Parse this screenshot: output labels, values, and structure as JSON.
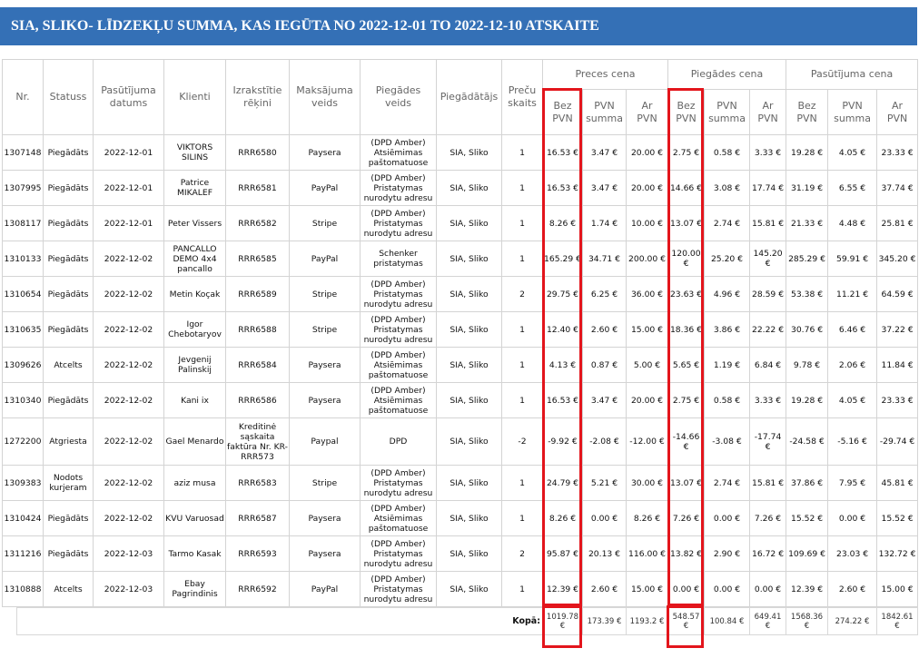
{
  "title": "SIA, SLIKO- LĪDZEKĻU SUMMA, KAS IEGŪTA NO 2022-12-01 TO 2022-12-10 ATSKAITE",
  "colors": {
    "title_bar": "#3470b6",
    "title_text": "#ffffff",
    "highlight": "#e3151c"
  },
  "table": {
    "headers": {
      "nr": "Nr.",
      "status": "Statuss",
      "order_date": "Pasūtījuma datums",
      "client": "Klienti",
      "invoices": "Izrakstītie rēķini",
      "payment": "Maksājuma veids",
      "delivery": "Piegādes veids",
      "supplier": "Piegādātājs",
      "qty": "Preču skaits",
      "groups": [
        "Preces cena",
        "Piegādes cena",
        "Pasūtījuma cena"
      ],
      "sub": [
        "Bez PVN",
        "PVN summa",
        "Ar PVN"
      ]
    },
    "rows": [
      {
        "nr": "1307148",
        "status": "Piegādāts",
        "date": "2022-12-01",
        "client": "VIKTORS SILINS",
        "invoice": "RRR6580",
        "payment": "Paysera",
        "delivery": "(DPD Amber) Atsiēmimas paštomatuose",
        "supplier": "SIA, Sliko",
        "qty": "1",
        "goods": [
          "16.53 €",
          "3.47 €",
          "20.00 €"
        ],
        "shipping": [
          "2.75 €",
          "0.58 €",
          "3.33 €"
        ],
        "order": [
          "19.28 €",
          "4.05 €",
          "23.33 €"
        ]
      },
      {
        "nr": "1307995",
        "status": "Piegādāts",
        "date": "2022-12-01",
        "client": "Patrice MIKALEF",
        "invoice": "RRR6581",
        "payment": "PayPal",
        "delivery": "(DPD Amber) Pristatymas nurodytu adresu",
        "supplier": "SIA, Sliko",
        "qty": "1",
        "goods": [
          "16.53 €",
          "3.47 €",
          "20.00 €"
        ],
        "shipping": [
          "14.66 €",
          "3.08 €",
          "17.74 €"
        ],
        "order": [
          "31.19 €",
          "6.55 €",
          "37.74 €"
        ]
      },
      {
        "nr": "1308117",
        "status": "Piegādāts",
        "date": "2022-12-01",
        "client": "Peter Vissers",
        "invoice": "RRR6582",
        "payment": "Stripe",
        "delivery": "(DPD Amber) Pristatymas nurodytu adresu",
        "supplier": "SIA, Sliko",
        "qty": "1",
        "goods": [
          "8.26 €",
          "1.74 €",
          "10.00 €"
        ],
        "shipping": [
          "13.07 €",
          "2.74 €",
          "15.81 €"
        ],
        "order": [
          "21.33 €",
          "4.48 €",
          "25.81 €"
        ]
      },
      {
        "nr": "1310133",
        "status": "Piegādāts",
        "date": "2022-12-02",
        "client": "PANCALLO DEMO 4x4 pancallo",
        "invoice": "RRR6585",
        "payment": "PayPal",
        "delivery": "Schenker pristatymas",
        "supplier": "SIA, Sliko",
        "qty": "1",
        "goods": [
          "165.29 €",
          "34.71 €",
          "200.00 €"
        ],
        "shipping": [
          "120.00 €",
          "25.20 €",
          "145.20 €"
        ],
        "order": [
          "285.29 €",
          "59.91 €",
          "345.20 €"
        ]
      },
      {
        "nr": "1310654",
        "status": "Piegādāts",
        "date": "2022-12-02",
        "client": "Metin Koçak",
        "invoice": "RRR6589",
        "payment": "Stripe",
        "delivery": "(DPD Amber) Pristatymas nurodytu adresu",
        "supplier": "SIA, Sliko",
        "qty": "2",
        "goods": [
          "29.75 €",
          "6.25 €",
          "36.00 €"
        ],
        "shipping": [
          "23.63 €",
          "4.96 €",
          "28.59 €"
        ],
        "order": [
          "53.38 €",
          "11.21 €",
          "64.59 €"
        ]
      },
      {
        "nr": "1310635",
        "status": "Piegādāts",
        "date": "2022-12-02",
        "client": "Igor Chebotaryov",
        "invoice": "RRR6588",
        "payment": "Stripe",
        "delivery": "(DPD Amber) Pristatymas nurodytu adresu",
        "supplier": "SIA, Sliko",
        "qty": "1",
        "goods": [
          "12.40 €",
          "2.60 €",
          "15.00 €"
        ],
        "shipping": [
          "18.36 €",
          "3.86 €",
          "22.22 €"
        ],
        "order": [
          "30.76 €",
          "6.46 €",
          "37.22 €"
        ]
      },
      {
        "nr": "1309626",
        "status": "Atcelts",
        "date": "2022-12-02",
        "client": "Jevgenij Palinskij",
        "invoice": "RRR6584",
        "payment": "Paysera",
        "delivery": "(DPD Amber) Atsiēmimas paštomatuose",
        "supplier": "SIA, Sliko",
        "qty": "1",
        "goods": [
          "4.13 €",
          "0.87 €",
          "5.00 €"
        ],
        "shipping": [
          "5.65 €",
          "1.19 €",
          "6.84 €"
        ],
        "order": [
          "9.78 €",
          "2.06 €",
          "11.84 €"
        ]
      },
      {
        "nr": "1310340",
        "status": "Piegādāts",
        "date": "2022-12-02",
        "client": "Kani ix",
        "invoice": "RRR6586",
        "payment": "Paysera",
        "delivery": "(DPD Amber) Atsiēmimas paštomatuose",
        "supplier": "SIA, Sliko",
        "qty": "1",
        "goods": [
          "16.53 €",
          "3.47 €",
          "20.00 €"
        ],
        "shipping": [
          "2.75 €",
          "0.58 €",
          "3.33 €"
        ],
        "order": [
          "19.28 €",
          "4.05 €",
          "23.33 €"
        ]
      },
      {
        "nr": "1272200",
        "status": "Atgriesta",
        "date": "2022-12-02",
        "client": "Gael Menardo",
        "invoice": "Kreditinė sąskaita faktūra Nr. KR-RRR573",
        "payment": "Paypal",
        "delivery": "DPD",
        "supplier": "SIA, Sliko",
        "qty": "-2",
        "goods": [
          "-9.92 €",
          "-2.08 €",
          "-12.00 €"
        ],
        "shipping": [
          "-14.66 €",
          "-3.08 €",
          "-17.74 €"
        ],
        "order": [
          "-24.58 €",
          "-5.16 €",
          "-29.74 €"
        ]
      },
      {
        "nr": "1309383",
        "status": "Nodots kurjeram",
        "date": "2022-12-02",
        "client": "aziz musa",
        "invoice": "RRR6583",
        "payment": "Stripe",
        "delivery": "(DPD Amber) Pristatymas nurodytu adresu",
        "supplier": "SIA, Sliko",
        "qty": "1",
        "goods": [
          "24.79 €",
          "5.21 €",
          "30.00 €"
        ],
        "shipping": [
          "13.07 €",
          "2.74 €",
          "15.81 €"
        ],
        "order": [
          "37.86 €",
          "7.95 €",
          "45.81 €"
        ]
      },
      {
        "nr": "1310424",
        "status": "Piegādāts",
        "date": "2022-12-02",
        "client": "KVU Varuosad",
        "invoice": "RRR6587",
        "payment": "Paysera",
        "delivery": "(DPD Amber) Atsiēmimas paštomatuose",
        "supplier": "SIA, Sliko",
        "qty": "1",
        "goods": [
          "8.26 €",
          "0.00 €",
          "8.26 €"
        ],
        "shipping": [
          "7.26 €",
          "0.00 €",
          "7.26 €"
        ],
        "order": [
          "15.52 €",
          "0.00 €",
          "15.52 €"
        ]
      },
      {
        "nr": "1311216",
        "status": "Piegādāts",
        "date": "2022-12-03",
        "client": "Tarmo Kasak",
        "invoice": "RRR6593",
        "payment": "Paysera",
        "delivery": "(DPD Amber) Pristatymas nurodytu adresu",
        "supplier": "SIA, Sliko",
        "qty": "2",
        "goods": [
          "95.87 €",
          "20.13 €",
          "116.00 €"
        ],
        "shipping": [
          "13.82 €",
          "2.90 €",
          "16.72 €"
        ],
        "order": [
          "109.69 €",
          "23.03 €",
          "132.72 €"
        ]
      },
      {
        "nr": "1310888",
        "status": "Atcelts",
        "date": "2022-12-03",
        "client": "Ebay Pagrindinis",
        "invoice": "RRR6592",
        "payment": "PayPal",
        "delivery": "(DPD Amber) Pristatymas nurodytu adresu",
        "supplier": "SIA, Sliko",
        "qty": "1",
        "goods": [
          "12.39 €",
          "2.60 €",
          "15.00 €"
        ],
        "shipping": [
          "0.00 €",
          "0.00 €",
          "0.00 €"
        ],
        "order": [
          "12.39 €",
          "2.60 €",
          "15.00 €"
        ]
      }
    ]
  },
  "totals": {
    "label": "Kopā:",
    "goods": [
      "1019.78 €",
      "173.39 €",
      "1193.2 €"
    ],
    "shipping": [
      "548.57 €",
      "100.84 €",
      "649.41 €"
    ],
    "order": [
      "1568.36 €",
      "274.22 €",
      "1842.61 €"
    ]
  }
}
